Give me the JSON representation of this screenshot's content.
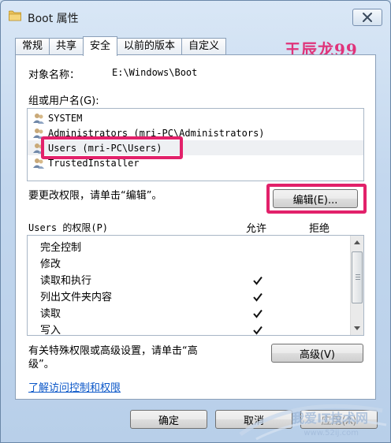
{
  "window": {
    "title": "Boot 属性"
  },
  "tabs": [
    {
      "label": "常规"
    },
    {
      "label": "共享"
    },
    {
      "label": "安全"
    },
    {
      "label": "以前的版本"
    },
    {
      "label": "自定义"
    }
  ],
  "watermark_top": "王辰龙99",
  "object": {
    "label": "对象名称：",
    "value": "E:\\Windows\\Boot"
  },
  "groups": {
    "label": "组或用户名(G):",
    "items": [
      {
        "name": "SYSTEM"
      },
      {
        "name": "Administrators (mri-PC\\Administrators)"
      },
      {
        "name": "Users (mri-PC\\Users)"
      },
      {
        "name": "TrustedInstaller"
      }
    ],
    "selected_index": 2
  },
  "change_perm_hint": "要更改权限，请单击“编辑”。",
  "edit_button": "编辑(E)...",
  "permissions": {
    "label": "Users 的权限(P)",
    "allow_header": "允许",
    "deny_header": "拒绝",
    "rows": [
      {
        "name": "完全控制",
        "allow": false,
        "deny": false
      },
      {
        "name": "修改",
        "allow": false,
        "deny": false
      },
      {
        "name": "读取和执行",
        "allow": true,
        "deny": false
      },
      {
        "name": "列出文件夹内容",
        "allow": true,
        "deny": false
      },
      {
        "name": "读取",
        "allow": true,
        "deny": false
      },
      {
        "name": "写入",
        "allow": true,
        "deny": false
      }
    ]
  },
  "special_hint_line1": "有关特殊权限或高级设置，请单击“高",
  "special_hint_line2": "级”。",
  "advanced_button": "高级(V)",
  "learn_link": "了解访问控制和权限",
  "ok_button": "确定",
  "cancel_button": "取消",
  "apply_button": "应用(A)",
  "watermark_bottom": "我爱IT技术网",
  "watermark_bottom_sub": "www.52ij.com"
}
